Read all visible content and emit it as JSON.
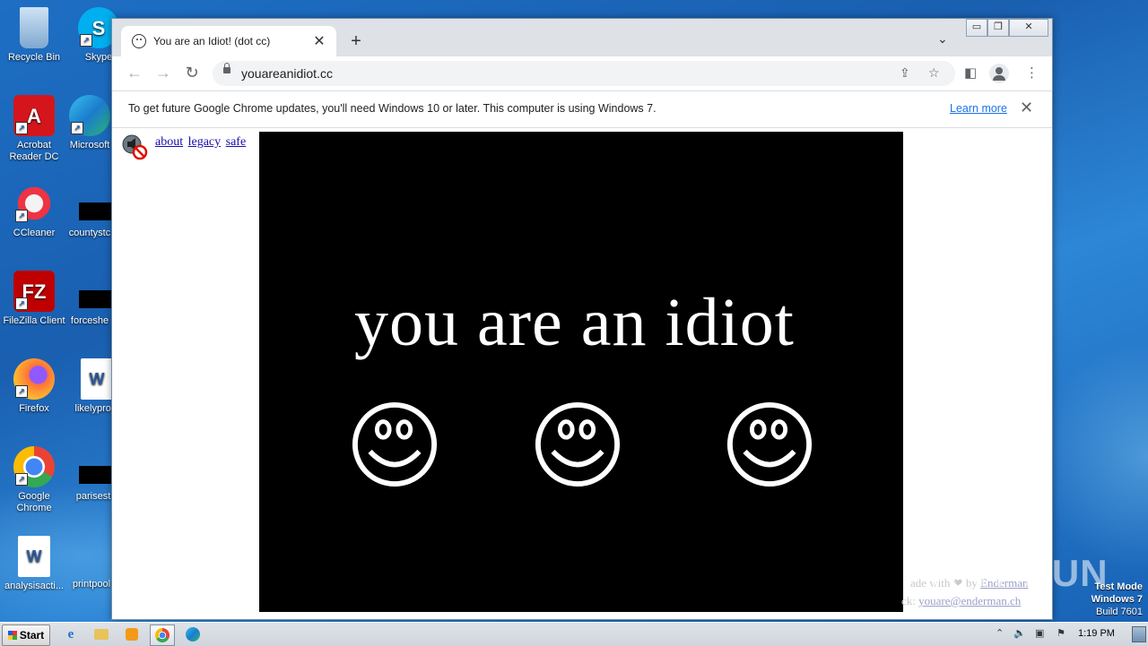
{
  "desktop": {
    "icons": [
      {
        "label": "Recycle Bin"
      },
      {
        "label": "Skype"
      },
      {
        "label": "Acrobat Reader DC"
      },
      {
        "label": "Microsoft"
      },
      {
        "label": "CCleaner"
      },
      {
        "label": "countystc"
      },
      {
        "label": "FileZilla Client"
      },
      {
        "label": "forceshe"
      },
      {
        "label": "Firefox"
      },
      {
        "label": "likelyproje"
      },
      {
        "label": "Google Chrome"
      },
      {
        "label": "parisest"
      },
      {
        "label": "analysisacti..."
      },
      {
        "label": "printpool"
      }
    ],
    "watermark": "ANY RUN",
    "test_mode": {
      "line1": "Test Mode",
      "line2": "Windows 7",
      "line3": "Build 7601"
    }
  },
  "browser": {
    "tab": {
      "title": "You are an Idiot! (dot cc)",
      "close": "✕"
    },
    "new_tab": "+",
    "tab_dropdown": "⌄",
    "window_controls": {
      "minimize": "▭",
      "restore": "❐",
      "close": "✕"
    },
    "nav": {
      "back": "←",
      "forward": "→",
      "reload": "↻"
    },
    "url": "youareanidiot.cc",
    "infobar": {
      "message": "To get future Google Chrome updates, you'll need Windows 10 or later. This computer is using Windows 7.",
      "learn_more": "Learn more",
      "close": "✕"
    }
  },
  "page": {
    "links": [
      "about",
      "legacy",
      "safe"
    ],
    "video_text": "you are an idiot",
    "footer": {
      "line1_prefix": "ade with",
      "line1_by": "by",
      "line1_link": "Enderman",
      "line2_prefix": "ck:",
      "line2_link": "youare@enderman.ch"
    }
  },
  "taskbar": {
    "start": "Start",
    "clock": "1:19 PM"
  }
}
